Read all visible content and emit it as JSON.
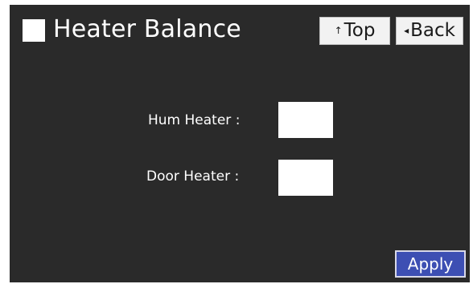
{
  "header": {
    "title": "Heater Balance",
    "top_button": {
      "arrow_icon": "up-arrow-icon",
      "label": "Top"
    },
    "back_button": {
      "arrow_icon": "left-triangle-icon",
      "label": "Back"
    }
  },
  "fields": [
    {
      "label": "Hum Heater  :",
      "value": ""
    },
    {
      "label": "Door Heater  :",
      "value": ""
    }
  ],
  "apply_button": {
    "label": "Apply"
  },
  "colors": {
    "background": "#2a2a2a",
    "apply": "#3d4fb3",
    "text": "#ffffff"
  }
}
